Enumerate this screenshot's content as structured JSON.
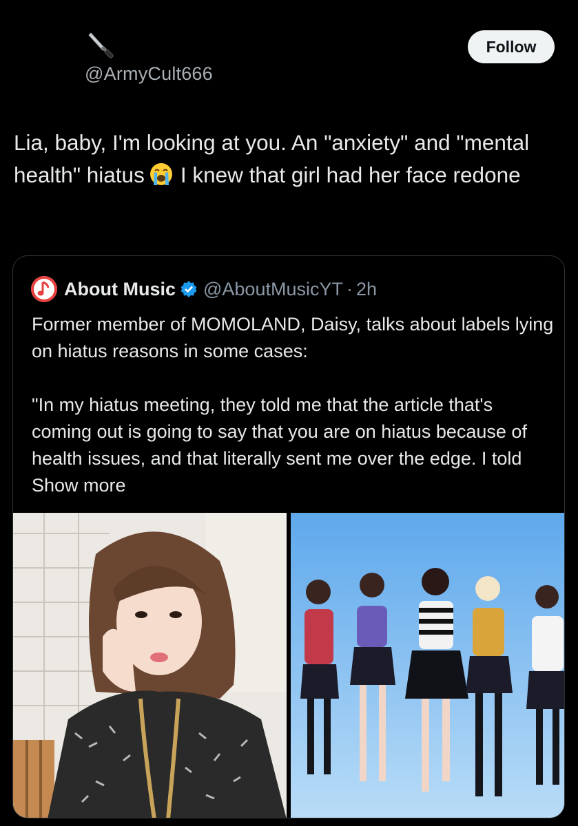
{
  "tweet": {
    "author": {
      "display_name_icon": "dagger-emoji-icon",
      "handle": "@ArmyCult666"
    },
    "follow_label": "Follow",
    "text_part1": "Lia, baby, I'm looking at you.  An \"anxiety\" and \"mental health\" hiatus",
    "emoji_icon": "loudly-crying-face-emoji-icon",
    "text_part2": "I knew that girl had her face redone"
  },
  "quote": {
    "avatar_icon": "music-note-icon",
    "name": "About Music",
    "verified_icon": "verified-badge-icon",
    "handle": "@AboutMusicYT",
    "separator": "·",
    "time": "2h",
    "paragraph1": "Former member of MOMOLAND, Daisy, talks about labels lying on hiatus reasons in some cases:",
    "paragraph2": "\"In my hiatus meeting, they told me that the article that's coming out is going to say that you are on hiatus because of health issues, and that literally sent me over the edge.  I told",
    "show_more": "Show more",
    "media": [
      {
        "name": "portrait-photo"
      },
      {
        "name": "group-dance-photo"
      }
    ]
  },
  "colors": {
    "background": "#000000",
    "text": "#e7e9ea",
    "secondary_text": "#8b98a5",
    "verified_blue": "#1d9bf0",
    "follow_bg": "#eff3f4"
  }
}
